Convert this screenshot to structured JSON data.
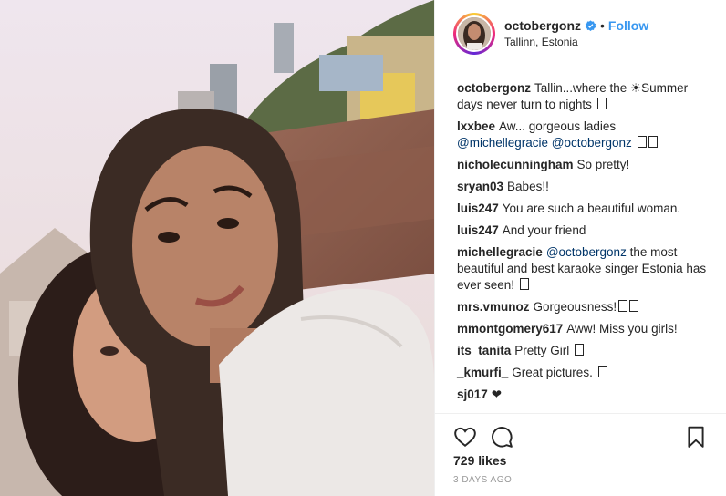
{
  "header": {
    "username": "octobergonz",
    "follow_label": "Follow",
    "location": "Tallinn, Estonia"
  },
  "comments": [
    {
      "user": "octobergonz",
      "text": "Tallin...where the ☀Summer days never turn to nights",
      "box": true
    },
    {
      "user": "lxxbee",
      "text": "Aw... gorgeous ladies",
      "mentions": "@michellegracie @octobergonz",
      "box2": true
    },
    {
      "user": "nicholecunningham",
      "text": "So pretty!"
    },
    {
      "user": "sryan03",
      "text": "Babes!!"
    },
    {
      "user": "luis247",
      "text": "You are such a beautiful woman."
    },
    {
      "user": "luis247",
      "text": "And your friend"
    },
    {
      "user": "michellegracie",
      "mention": "@octobergonz",
      "text": "the most beautiful and best karaoke singer Estonia has ever seen!",
      "box": true
    },
    {
      "user": "mrs.vmunoz",
      "text": "Gorgeousness!",
      "box2": true
    },
    {
      "user": "mmontgomery617",
      "text": "Aww! Miss you girls!"
    },
    {
      "user": "its_tanita",
      "text": "Pretty Girl",
      "box": true
    },
    {
      "user": "_kmurfi_",
      "text": "Great pictures.",
      "box": true
    },
    {
      "user": "sj017",
      "text": "❤"
    }
  ],
  "likes": "729 likes",
  "timestamp": "3 DAYS AGO",
  "icons": {
    "like": "heart-icon",
    "comment": "comment-icon",
    "save": "bookmark-icon",
    "verified": "verified-badge-icon"
  },
  "colors": {
    "accent": "#3897f0",
    "mention": "#003569",
    "muted": "#999999"
  }
}
